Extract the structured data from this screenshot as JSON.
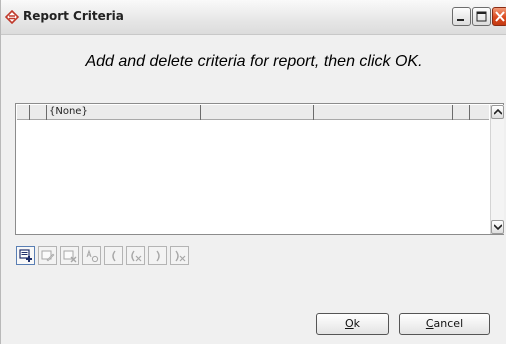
{
  "window": {
    "title": "Report Criteria"
  },
  "instruction": "Add and delete criteria for report, then click OK.",
  "grid": {
    "rows": [
      {
        "cells": [
          "",
          "",
          "{None}",
          "",
          "",
          "",
          ""
        ]
      }
    ]
  },
  "toolbar": {
    "buttons": [
      {
        "name": "add-criteria-icon",
        "state": "active"
      },
      {
        "name": "edit-criteria-icon",
        "state": "disabled"
      },
      {
        "name": "delete-criteria-icon",
        "state": "disabled"
      },
      {
        "name": "and-or-icon",
        "state": "disabled"
      },
      {
        "name": "open-paren-icon",
        "state": "disabled"
      },
      {
        "name": "remove-open-paren-icon",
        "state": "disabled"
      },
      {
        "name": "close-paren-icon",
        "state": "disabled"
      },
      {
        "name": "remove-close-paren-icon",
        "state": "disabled"
      }
    ]
  },
  "buttons": {
    "ok": {
      "mnemonic": "O",
      "rest": "k"
    },
    "cancel": {
      "mnemonic": "C",
      "rest": "ancel"
    }
  },
  "colors": {
    "close_button": "#d9491f",
    "title_icon": "#c0392b"
  }
}
